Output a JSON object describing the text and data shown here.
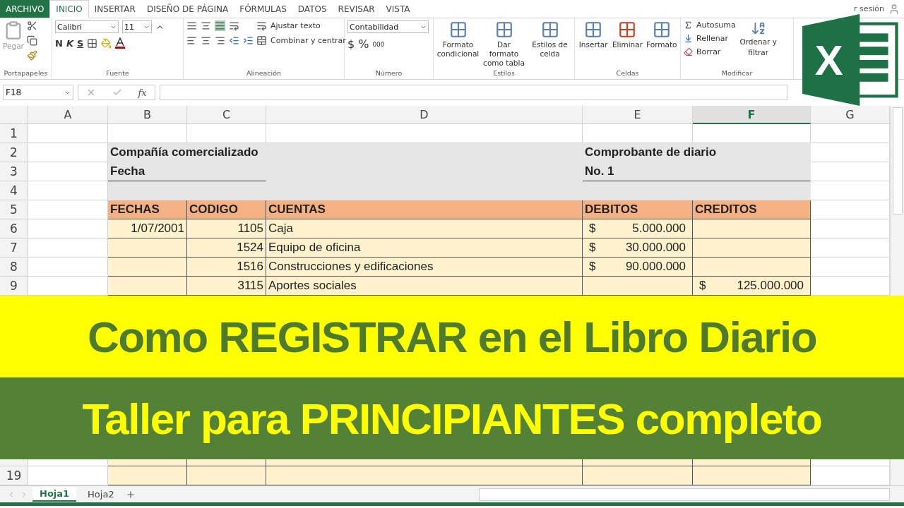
{
  "menu_tabs": [
    {
      "label": "ARCHIVO",
      "kind": "file",
      "selected": false
    },
    {
      "label": "INICIO",
      "kind": "tab",
      "selected": true
    },
    {
      "label": "INSERTAR",
      "kind": "tab",
      "selected": false
    },
    {
      "label": "DISEÑO DE PÁGINA",
      "kind": "tab",
      "selected": false
    },
    {
      "label": "FÓRMULAS",
      "kind": "tab",
      "selected": false
    },
    {
      "label": "DATOS",
      "kind": "tab",
      "selected": false
    },
    {
      "label": "REVISAR",
      "kind": "tab",
      "selected": false
    },
    {
      "label": "VISTA",
      "kind": "tab",
      "selected": false
    }
  ],
  "account": "r sesión",
  "ribbon": {
    "clipboard": {
      "paste": "Pegar",
      "label": "Portapapeles"
    },
    "font": {
      "name": "Calibri",
      "size": "11",
      "styles": [
        "N",
        "K",
        "S"
      ],
      "label": "Fuente"
    },
    "alignment": {
      "wrap": "Ajustar texto",
      "merge": "Combinar y centrar",
      "label": "Alineación"
    },
    "number": {
      "format": "Contabilidad",
      "symbols": [
        "$",
        "%",
        "000"
      ],
      "label": "Número"
    },
    "styles": {
      "buttons": [
        "Formato condicional",
        "Dar formato como tabla",
        "Estilos de celda"
      ],
      "label": "Estilos"
    },
    "cells": {
      "buttons": [
        "Insertar",
        "Eliminar",
        "Formato"
      ],
      "label": "Celdas"
    },
    "editing": {
      "items": [
        "Autosuma",
        "Rellenar",
        "Borrar"
      ],
      "sort": "Ordenar y",
      "sort_2": "filtrar",
      "label": "Modificar"
    }
  },
  "logo_letter": "X",
  "formula_bar": {
    "name_box": "F18",
    "function_label": "fx"
  },
  "columns": [
    {
      "label": "A",
      "selected": false
    },
    {
      "label": "B",
      "selected": false
    },
    {
      "label": "C",
      "selected": false
    },
    {
      "label": "D",
      "selected": false
    },
    {
      "label": "E",
      "selected": false
    },
    {
      "label": "F",
      "selected": true
    },
    {
      "label": "G",
      "selected": false
    }
  ],
  "rows": [
    {
      "number": "1",
      "kind": "blank"
    },
    {
      "number": "2",
      "kind": "title",
      "b": "Compañía comercializado",
      "e": "Comprobante de diario"
    },
    {
      "number": "3",
      "kind": "title_end",
      "b": "Fecha",
      "e": "No. 1"
    },
    {
      "number": "4",
      "kind": "gap"
    },
    {
      "number": "5",
      "kind": "header",
      "b": "FECHAS",
      "c": "CODIGO",
      "d": "CUENTAS",
      "e": "DEBITOS",
      "f": "CREDITOS"
    },
    {
      "number": "6",
      "kind": "data",
      "b": "1/07/2001",
      "c": "1105",
      "d": "Caja",
      "e": {
        "currency": "$",
        "amount": "5.000.000"
      }
    },
    {
      "number": "7",
      "kind": "data",
      "c": "1524",
      "d": "Equipo de oficina",
      "e": {
        "currency": "$",
        "amount": "30.000.000"
      }
    },
    {
      "number": "8",
      "kind": "data",
      "c": "1516",
      "d": "Construcciones y edificaciones",
      "e": {
        "currency": "$",
        "amount": "90.000.000"
      }
    },
    {
      "number": "9",
      "kind": "data",
      "c": "3115",
      "d": "Aportes sociales",
      "f": {
        "currency": "$",
        "amount": "125.000.000"
      }
    }
  ],
  "banner": {
    "line_1": "Como REGISTRAR en el Libro Diario",
    "line_2": "Taller para PRINCIPIANTES completo"
  },
  "bottom_rows": [
    {
      "number": "19",
      "kind": "data"
    }
  ],
  "sheet_tabs": [
    {
      "label": "Hoja1",
      "selected": true
    },
    {
      "label": "Hoja2",
      "selected": false
    }
  ]
}
